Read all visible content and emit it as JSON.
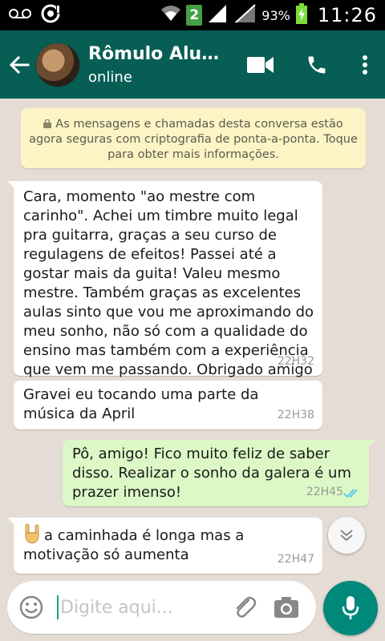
{
  "status_bar": {
    "network_badge": "2",
    "battery": "93%",
    "time": "11:26",
    "icons": [
      "voicemail-icon",
      "sync-icon",
      "wifi-icon",
      "signal-icon",
      "signal-off-icon",
      "battery-charging-icon"
    ]
  },
  "header": {
    "contact_name": "Rômulo Alu…",
    "contact_status": "online",
    "icons": [
      "back-arrow-icon",
      "video-call-icon",
      "phone-icon",
      "more-vert-icon"
    ],
    "bg_color": "#075e54"
  },
  "encryption_notice": "As mensagens e chamadas desta conversa estão agora seguras com criptografia de ponta-a-ponta. Toque para obter mais informações.",
  "messages": [
    {
      "direction": "incoming",
      "text": "Cara, momento \"ao mestre com carinho\". Achei um timbre muito legal pra guitarra, graças a seu curso de regulagens de efeitos! Passei até a gostar mais da guita! Valeu mesmo mestre. Também graças as excelentes aulas sinto que vou me aproximando do meu sonho, não só com a qualidade do ensino mas também com a experiência que vem me passando. Obrigado amigo",
      "time": "22H32"
    },
    {
      "direction": "incoming",
      "text": "Gravei eu tocando uma parte da música da April",
      "time": "22H38"
    },
    {
      "direction": "outgoing",
      "text": "Pô, amigo! Fico muito feliz de saber disso. Realizar o sonho da galera é um prazer imenso!",
      "time": "22H45",
      "status": "read-double-check-icon"
    },
    {
      "direction": "incoming",
      "emoji": "rock-hand-icon",
      "text": "a caminhada é longa mas a motivação só aumenta",
      "time": "22H47"
    }
  ],
  "input": {
    "placeholder": "Digite aqui...",
    "value": ""
  },
  "colors": {
    "chat_bg": "#e5ddd5",
    "outgoing_bubble": "#dcf8c6",
    "notice_bg": "#fdf4c5",
    "mic_button": "#00897b",
    "read_ticks": "#4fc3f7"
  }
}
